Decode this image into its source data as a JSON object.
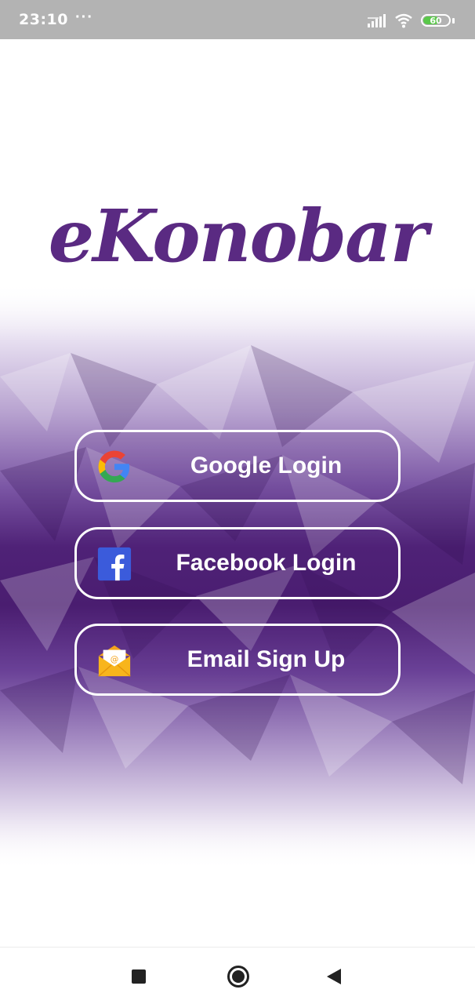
{
  "status_bar": {
    "time": "23:10",
    "dots": "···",
    "battery_level": "60",
    "battery_fraction": 0.6,
    "battery_color": "#5ac84a"
  },
  "logo": {
    "text": "eKonobar",
    "color": "#5a2a82"
  },
  "buttons": {
    "google": {
      "label": "Google Login",
      "icon": "google-icon"
    },
    "facebook": {
      "label": "Facebook Login",
      "icon": "facebook-icon"
    },
    "email": {
      "label": "Email Sign Up",
      "icon": "envelope-icon"
    }
  },
  "theme": {
    "accent": "#4b1f6f",
    "accent_light": "#8a6aaf",
    "facebook_blue": "#3b5bdb",
    "envelope_yellow": "#f8b51c"
  },
  "nav": {
    "recent": "recent-apps-icon",
    "home": "home-icon",
    "back": "back-icon"
  }
}
